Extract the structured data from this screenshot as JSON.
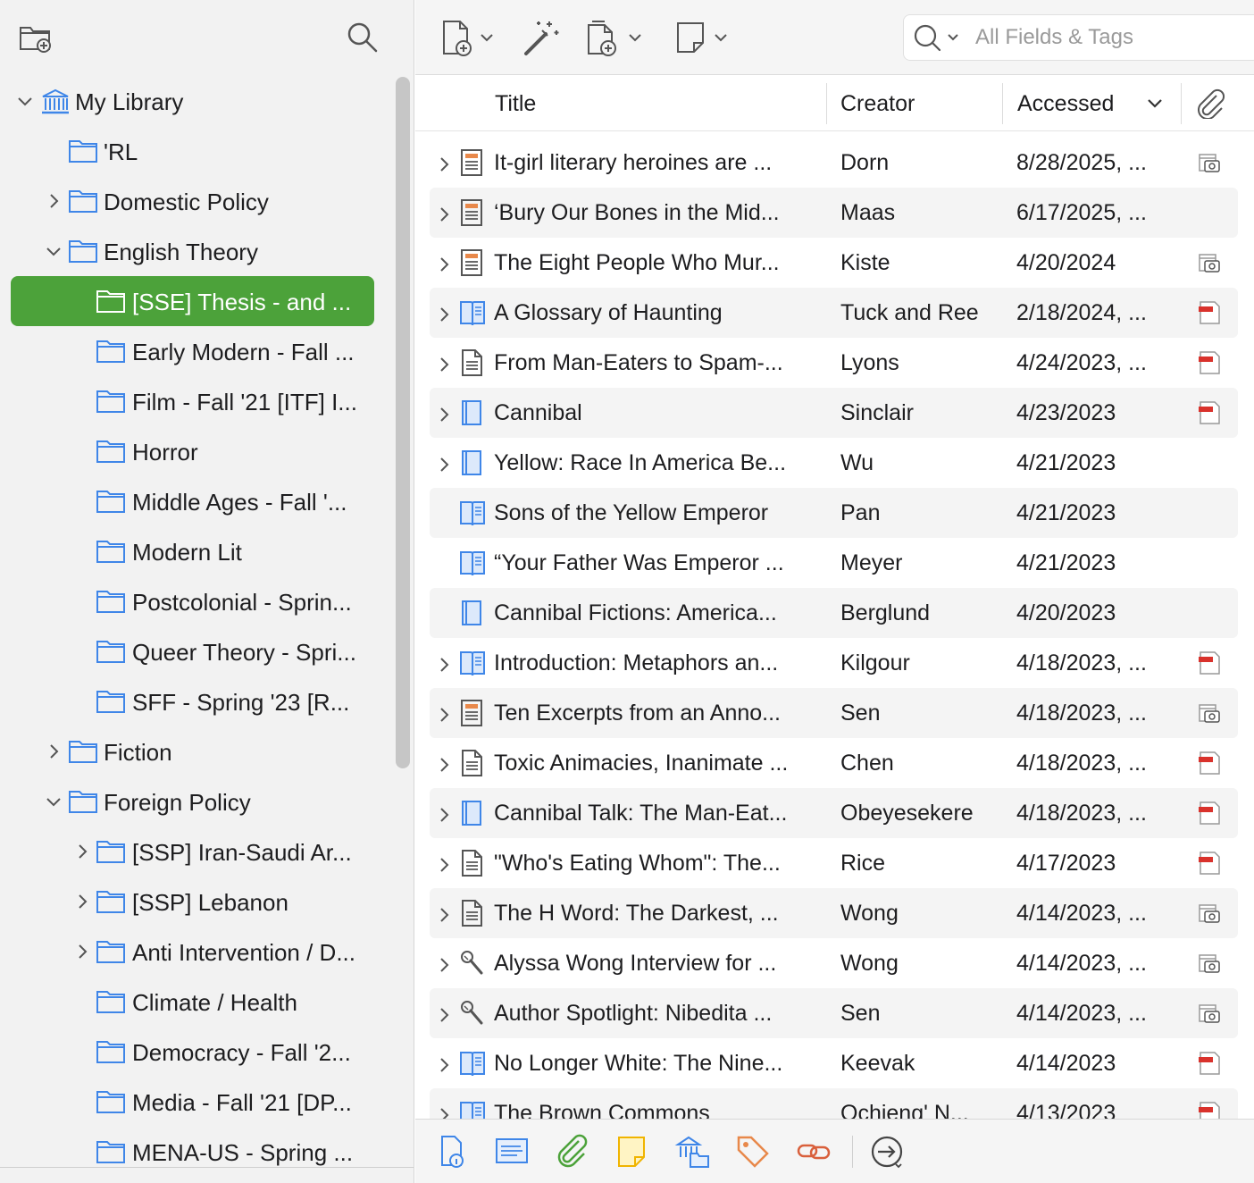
{
  "colors": {
    "selected": "#4ca23a",
    "folder": "#3f86e8",
    "pdf_red": "#d9322c",
    "icon_gray": "#555555"
  },
  "sidebar": {
    "new_collection_icon": "new-collection-icon",
    "search_icon": "search-icon",
    "tree": [
      {
        "label": "My Library",
        "level": 0,
        "chev": "down",
        "icon": "library"
      },
      {
        "label": "'RL",
        "level": 1,
        "chev": "",
        "icon": "folder"
      },
      {
        "label": "Domestic Policy",
        "level": 1,
        "chev": "right",
        "icon": "folder"
      },
      {
        "label": "English Theory",
        "level": 1,
        "chev": "down",
        "icon": "folder"
      },
      {
        "label": "[SSE] Thesis - and ...",
        "level": 2,
        "chev": "",
        "icon": "folder",
        "selected": true
      },
      {
        "label": "Early Modern - Fall ...",
        "level": 2,
        "chev": "",
        "icon": "folder"
      },
      {
        "label": "Film - Fall '21 [ITF] I...",
        "level": 2,
        "chev": "",
        "icon": "folder"
      },
      {
        "label": "Horror",
        "level": 2,
        "chev": "",
        "icon": "folder"
      },
      {
        "label": "Middle Ages - Fall '...",
        "level": 2,
        "chev": "",
        "icon": "folder"
      },
      {
        "label": "Modern Lit",
        "level": 2,
        "chev": "",
        "icon": "folder"
      },
      {
        "label": "Postcolonial - Sprin...",
        "level": 2,
        "chev": "",
        "icon": "folder"
      },
      {
        "label": "Queer Theory - Spri...",
        "level": 2,
        "chev": "",
        "icon": "folder"
      },
      {
        "label": "SFF - Spring '23 [R...",
        "level": 2,
        "chev": "",
        "icon": "folder"
      },
      {
        "label": "Fiction",
        "level": 1,
        "chev": "right",
        "icon": "folder"
      },
      {
        "label": "Foreign Policy",
        "level": 1,
        "chev": "down",
        "icon": "folder"
      },
      {
        "label": "[SSP] Iran-Saudi Ar...",
        "level": 2,
        "chev": "right",
        "icon": "folder"
      },
      {
        "label": "[SSP] Lebanon",
        "level": 2,
        "chev": "right",
        "icon": "folder"
      },
      {
        "label": "Anti Intervention / D...",
        "level": 2,
        "chev": "right",
        "icon": "folder"
      },
      {
        "label": "Climate / Health",
        "level": 2,
        "chev": "",
        "icon": "folder"
      },
      {
        "label": "Democracy - Fall '2...",
        "level": 2,
        "chev": "",
        "icon": "folder"
      },
      {
        "label": "Media - Fall '21 [DP...",
        "level": 2,
        "chev": "",
        "icon": "folder"
      },
      {
        "label": "MENA-US - Spring ...",
        "level": 2,
        "chev": "",
        "icon": "folder"
      }
    ]
  },
  "toolbar": {
    "new_item_icon": "new-item-icon",
    "magic_wand_icon": "magic-wand-icon",
    "add_attachment_icon": "add-attachment-icon",
    "new_note_icon": "new-note-icon",
    "search_placeholder": "All Fields & Tags"
  },
  "columns": {
    "title": "Title",
    "creator": "Creator",
    "accessed": "Accessed"
  },
  "items": [
    {
      "title": "It-girl literary heroines are ...",
      "creator": "Dorn",
      "accessed": "8/28/2025, ...",
      "type": "webpage",
      "chev": true,
      "att": "snapshot"
    },
    {
      "title": "‘Bury Our Bones in the Mid...",
      "creator": "Maas",
      "accessed": "6/17/2025, ...",
      "type": "webpage",
      "chev": true,
      "att": ""
    },
    {
      "title": "The Eight People Who Mur...",
      "creator": "Kiste",
      "accessed": "4/20/2024",
      "type": "webpage",
      "chev": true,
      "att": "snapshot"
    },
    {
      "title": "A Glossary of Haunting",
      "creator": "Tuck and Ree",
      "accessed": "2/18/2024, ...",
      "type": "booksection",
      "chev": true,
      "att": "pdf"
    },
    {
      "title": "From Man-Eaters to Spam-...",
      "creator": "Lyons",
      "accessed": "4/24/2023, ...",
      "type": "article",
      "chev": true,
      "att": "pdf"
    },
    {
      "title": "Cannibal",
      "creator": "Sinclair",
      "accessed": "4/23/2023",
      "type": "book",
      "chev": true,
      "att": "pdf"
    },
    {
      "title": "Yellow: Race In America Be...",
      "creator": "Wu",
      "accessed": "4/21/2023",
      "type": "book",
      "chev": true,
      "att": ""
    },
    {
      "title": "Sons of the Yellow Emperor",
      "creator": "Pan",
      "accessed": "4/21/2023",
      "type": "booksection",
      "chev": false,
      "att": ""
    },
    {
      "title": "“Your Father Was Emperor ...",
      "creator": "Meyer",
      "accessed": "4/21/2023",
      "type": "booksection",
      "chev": false,
      "att": ""
    },
    {
      "title": "Cannibal Fictions: America...",
      "creator": "Berglund",
      "accessed": "4/20/2023",
      "type": "book",
      "chev": false,
      "att": ""
    },
    {
      "title": "Introduction: Metaphors an...",
      "creator": "Kilgour",
      "accessed": "4/18/2023, ...",
      "type": "booksection",
      "chev": true,
      "att": "pdf"
    },
    {
      "title": "Ten Excerpts from an Anno...",
      "creator": "Sen",
      "accessed": "4/18/2023, ...",
      "type": "webpage",
      "chev": true,
      "att": "snapshot"
    },
    {
      "title": "Toxic Animacies, Inanimate ...",
      "creator": "Chen",
      "accessed": "4/18/2023, ...",
      "type": "article",
      "chev": true,
      "att": "pdf"
    },
    {
      "title": "Cannibal Talk: The Man-Eat...",
      "creator": "Obeyesekere",
      "accessed": "4/18/2023, ...",
      "type": "book",
      "chev": true,
      "att": "pdf"
    },
    {
      "title": "\"Who's Eating Whom\": The...",
      "creator": "Rice",
      "accessed": "4/17/2023",
      "type": "article",
      "chev": true,
      "att": "pdf"
    },
    {
      "title": "The H Word: The Darkest, ...",
      "creator": "Wong",
      "accessed": "4/14/2023, ...",
      "type": "article",
      "chev": true,
      "att": "snapshot"
    },
    {
      "title": "Alyssa Wong Interview for ...",
      "creator": "Wong",
      "accessed": "4/14/2023, ...",
      "type": "interview",
      "chev": true,
      "att": "snapshot"
    },
    {
      "title": "Author Spotlight: Nibedita ...",
      "creator": "Sen",
      "accessed": "4/14/2023, ...",
      "type": "interview",
      "chev": true,
      "att": "snapshot"
    },
    {
      "title": "No Longer White: The Nine...",
      "creator": "Keevak",
      "accessed": "4/14/2023",
      "type": "booksection",
      "chev": true,
      "att": "pdf"
    },
    {
      "title": "The Brown Commons",
      "creator": "Ochieng' N...",
      "accessed": "4/13/2023",
      "type": "booksection",
      "chev": true,
      "att": "pdf"
    }
  ],
  "bottom_bar": [
    {
      "name": "item-info-icon",
      "color": "#3f86e8"
    },
    {
      "name": "abstract-icon",
      "color": "#3f86e8"
    },
    {
      "name": "attachments-icon",
      "color": "#4ca23a"
    },
    {
      "name": "notes-icon",
      "color": "#f0b400"
    },
    {
      "name": "libraries-collections-icon",
      "color": "#3f86e8"
    },
    {
      "name": "tags-icon",
      "color": "#e8884a"
    },
    {
      "name": "related-icon",
      "color": "#d9603c"
    },
    {
      "name": "locate-icon",
      "color": "#444444"
    }
  ]
}
